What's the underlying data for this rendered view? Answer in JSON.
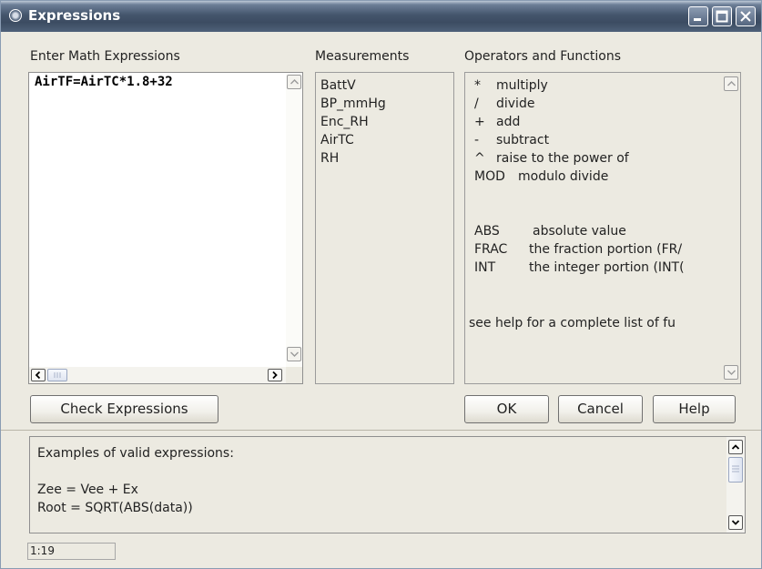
{
  "window": {
    "title": "Expressions"
  },
  "icons": {
    "app": "app-icon",
    "minimize": "minimize-icon",
    "maximize": "maximize-icon",
    "close": "close-icon"
  },
  "labels": {
    "expressions": "Enter Math Expressions",
    "measurements": "Measurements",
    "operators": "Operators and Functions"
  },
  "expression_input": {
    "value": "AirTF=AirTC*1.8+32"
  },
  "measurements": [
    "BattV",
    "BP_mmHg",
    "Enc_RH",
    "AirTC",
    "RH"
  ],
  "operators": [
    {
      "sym": "*",
      "desc": "multiply"
    },
    {
      "sym": "/",
      "desc": "divide"
    },
    {
      "sym": "+",
      "desc": "add"
    },
    {
      "sym": "-",
      "desc": "subtract"
    },
    {
      "sym": "^",
      "desc": "raise to the power of"
    },
    {
      "sym": "MOD",
      "desc": "modulo divide"
    }
  ],
  "functions": [
    {
      "sym": "ABS",
      "desc": "absolute value"
    },
    {
      "sym": "FRAC",
      "desc": "the fraction portion (FR/"
    },
    {
      "sym": "INT",
      "desc": "the integer portion (INT("
    }
  ],
  "help_note": "see help for a complete list of fu",
  "buttons": {
    "check": "Check Expressions",
    "ok": "OK",
    "cancel": "Cancel",
    "help": "Help"
  },
  "examples": {
    "heading": "Examples of valid expressions:",
    "lines": [
      "Zee = Vee + Ex",
      "Root = SQRT(ABS(data))"
    ]
  },
  "status": {
    "position": "1:19"
  }
}
